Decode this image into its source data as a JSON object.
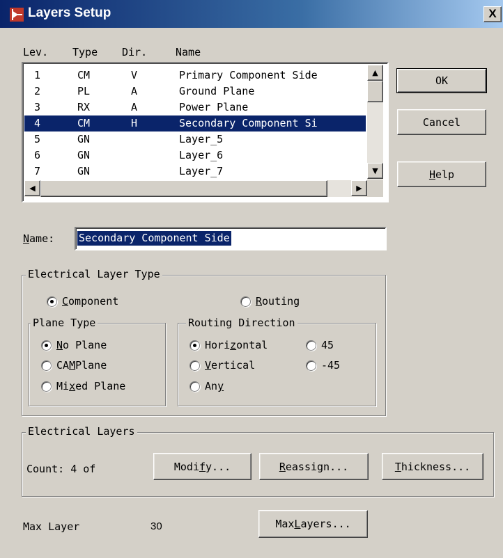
{
  "window": {
    "title": "Layers Setup",
    "close_glyph": "X",
    "icon": "layers-app-icon"
  },
  "columns": [
    "Lev.",
    "Type",
    "Dir.",
    "Name"
  ],
  "layers": [
    {
      "lev": "1",
      "type": "CM",
      "dir": "V",
      "name": "Primary Component Side"
    },
    {
      "lev": "2",
      "type": "PL",
      "dir": "A",
      "name": "Ground Plane"
    },
    {
      "lev": "3",
      "type": "RX",
      "dir": "A",
      "name": "Power Plane"
    },
    {
      "lev": "4",
      "type": "CM",
      "dir": "H",
      "name": "Secondary Component Si"
    },
    {
      "lev": "5",
      "type": "GN",
      "dir": "",
      "name": "Layer_5"
    },
    {
      "lev": "6",
      "type": "GN",
      "dir": "",
      "name": "Layer_6"
    },
    {
      "lev": "7",
      "type": "GN",
      "dir": "",
      "name": "Layer_7"
    }
  ],
  "selected_layer_index": 3,
  "buttons": {
    "ok": "OK",
    "cancel": "Cancel",
    "help_mnemonic": "H",
    "help_rest": "elp"
  },
  "name_field": {
    "label_mnemonic": "N",
    "label_rest": "ame:",
    "value": "Secondary Component Side"
  },
  "electrical_layer_type": {
    "label": "Electrical  Layer Type",
    "component_mnemonic": "C",
    "component_rest": "omponent",
    "routing_mnemonic": "R",
    "routing_rest": "outing",
    "selected": "component"
  },
  "plane_type": {
    "label": "Plane Type",
    "no_plane_mnemonic": "N",
    "no_plane_rest": "o Plane",
    "cam_plane_pre": "CA",
    "cam_plane_mnemonic": "M",
    "cam_plane_rest": " Plane",
    "mixed_plane_pre": "Mi",
    "mixed_plane_mnemonic": "x",
    "mixed_plane_rest": "ed Plane",
    "selected": "no_plane"
  },
  "routing_direction": {
    "label": "Routing Direction",
    "horizontal_pre": "Hori",
    "horizontal_mnemonic": "z",
    "horizontal_rest": "ontal",
    "deg45": "45",
    "vertical_mnemonic": "V",
    "vertical_rest": "ertical",
    "deg_neg45": "-45",
    "any_pre": "An",
    "any_mnemonic": "y",
    "selected": "horizontal"
  },
  "electrical_layers": {
    "label": "Electrical Layers",
    "count_text": "Count:  4 of",
    "modify_pre": "Modi",
    "modify_mnemonic": "f",
    "modify_rest": "y...",
    "reassign_mnemonic": "R",
    "reassign_rest": "eassign...",
    "thickness_mnemonic": "T",
    "thickness_rest": "hickness..."
  },
  "max_layer": {
    "label": "Max Layer",
    "value": "30",
    "button_pre": "Max ",
    "button_mnemonic": "L",
    "button_rest": "ayers..."
  },
  "colors": {
    "face": "#d4d0c8",
    "selection": "#0a246a",
    "title_start": "#0a246a",
    "title_end": "#a6caf0"
  }
}
